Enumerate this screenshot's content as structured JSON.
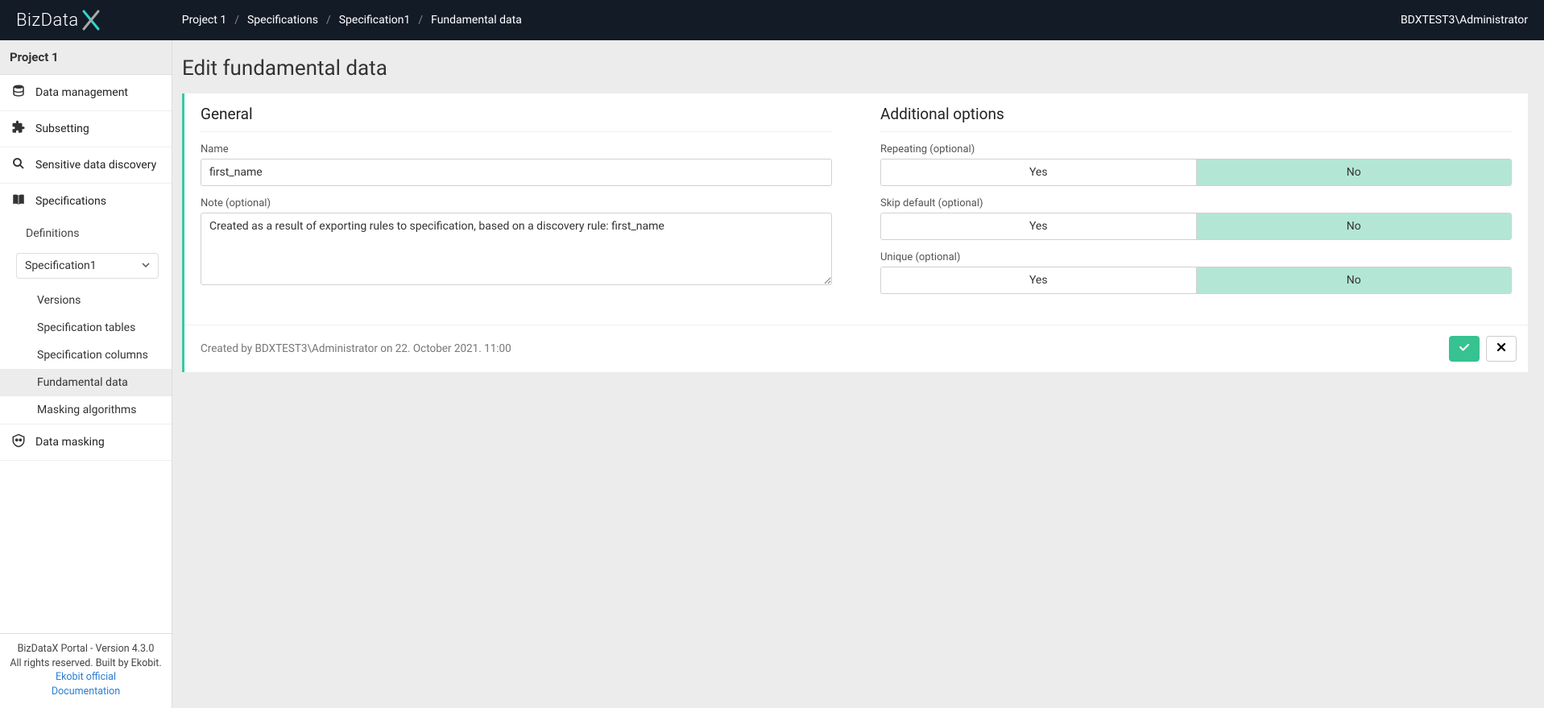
{
  "brand": "BizData",
  "breadcrumb": [
    "Project 1",
    "Specifications",
    "Specification1",
    "Fundamental data"
  ],
  "user": "BDXTEST3\\Administrator",
  "sidebar": {
    "project": "Project 1",
    "items": {
      "data_management": "Data management",
      "subsetting": "Subsetting",
      "sensitive": "Sensitive data discovery",
      "specifications": "Specifications",
      "data_masking": "Data masking"
    },
    "definitions": "Definitions",
    "spec_selected": "Specification1",
    "spec_children": {
      "versions": "Versions",
      "spec_tables": "Specification tables",
      "spec_columns": "Specification columns",
      "fundamental": "Fundamental data",
      "masking_alg": "Masking algorithms"
    }
  },
  "footer": {
    "version": "BizDataX Portal - Version 4.3.0",
    "rights": "All rights reserved. Built by Ekobit.",
    "link_official": "Ekobit official",
    "link_docs": "Documentation"
  },
  "page": {
    "title": "Edit fundamental data",
    "general": "General",
    "name_label": "Name",
    "name_value": "first_name",
    "note_label": "Note (optional)",
    "note_value": "Created as a result of exporting rules to specification, based on a discovery rule: first_name",
    "additional": "Additional options",
    "repeating_label": "Repeating (optional)",
    "skip_label": "Skip default (optional)",
    "unique_label": "Unique (optional)",
    "yes": "Yes",
    "no": "No",
    "meta": "Created by BDXTEST3\\Administrator on 22. October 2021. 11:00"
  }
}
